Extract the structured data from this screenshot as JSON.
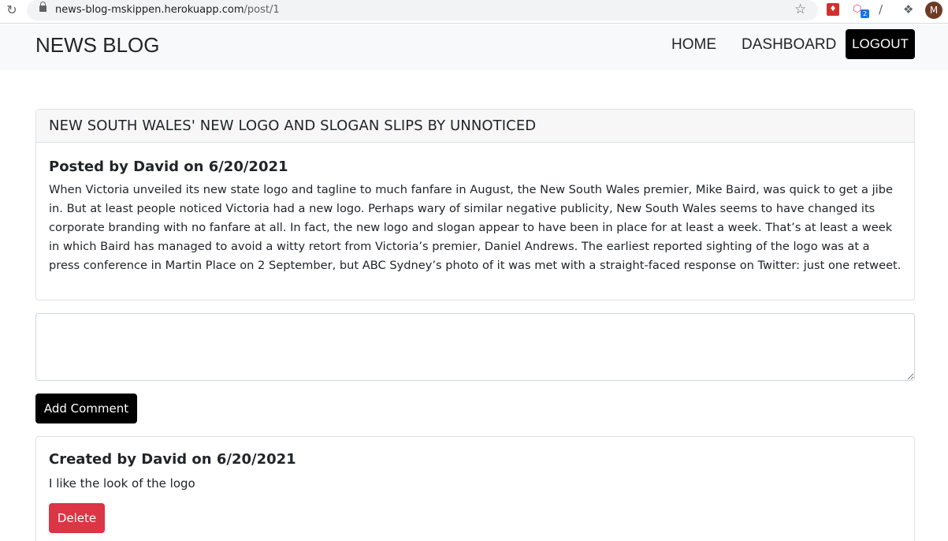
{
  "browser": {
    "url_host": "news-blog-mskippen.herokuapp.com",
    "url_path": "/post/1",
    "profile_initial": "M",
    "extension_badge": "2"
  },
  "navbar": {
    "brand": "NEWS BLOG",
    "home": "HOME",
    "dashboard": "DASHBOARD",
    "logout": "LOGOUT"
  },
  "post": {
    "title": "NEW SOUTH WALES' NEW LOGO AND SLOGAN SLIPS BY UNNOTICED",
    "meta": "Posted by David on 6/20/2021",
    "body": "When Victoria unveiled its new state logo and tagline to much fanfare in August, the New South Wales premier, Mike Baird, was quick to get a jibe in. But at least people noticed Victoria had a new logo. Perhaps wary of similar negative publicity, New South Wales seems to have changed its corporate branding with no fanfare at all. In fact, the new logo and slogan appear to have been in place for at least a week. That’s at least a week in which Baird has managed to avoid a witty retort from Victoria’s premier, Daniel Andrews. The earliest reported sighting of the logo was at a press conference in Martin Place on 2 September, but ABC Sydney’s photo of it was met with a straight-faced response on Twitter: just one retweet."
  },
  "comment_form": {
    "value": "",
    "submit_label": "Add Comment"
  },
  "comments": [
    {
      "meta": "Created by David on 6/20/2021",
      "text": "I like the look of the logo",
      "delete_label": "Delete"
    }
  ]
}
